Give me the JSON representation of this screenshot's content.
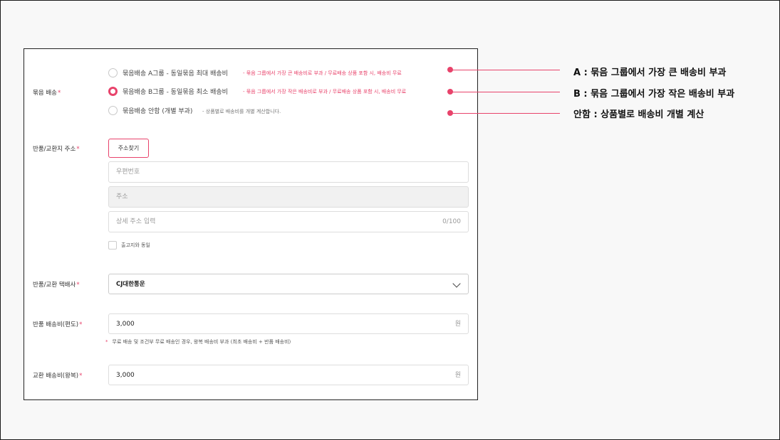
{
  "bundle_shipping": {
    "label": "묶음 배송",
    "required_mark": "*",
    "options": [
      {
        "label": "묶음배송 A그룹 - 동일묶음 최대 배송비",
        "note": "- 묶음 그룹에서 가장 큰 배송비로 부과 / 무료배송 상품 포함 시, 배송비 무료",
        "checked": false
      },
      {
        "label": "묶음배송 B그룹 - 동일묶음 최소 배송비",
        "note": "- 묶음 그룹에서 가장 작은 배송비로 부과 / 무료배송 상품 포함 시, 배송비 무료",
        "checked": true
      },
      {
        "label": "묶음배송 안함 (개별 부과)",
        "note": "- 상품별로 배송비를 개별 계산합니다.",
        "checked": false
      }
    ]
  },
  "return_address": {
    "label": "반품/교환지 주소",
    "required_mark": "*",
    "find_button": "주소찾기",
    "zip_placeholder": "우편번호",
    "address_placeholder": "주소",
    "detail_placeholder": "상세 주소 입력",
    "detail_counter": "0/100",
    "same_as_warehouse": "출고지와 동일"
  },
  "return_courier": {
    "label": "반품/교환 택배사",
    "required_mark": "*",
    "selected": "CJ대한통운"
  },
  "return_fee": {
    "label": "반품 배송비(편도)",
    "required_mark": "*",
    "value": "3,000",
    "unit": "원",
    "hint": "무료 배송 및 조건부 무료 배송인 경우, 왕복 배송비 부과 (최초 배송비 + 반품 배송비)",
    "hint_bullet": "*"
  },
  "exchange_fee": {
    "label": "교환 배송비(왕복)",
    "required_mark": "*",
    "value": "3,000",
    "unit": "원"
  },
  "callouts": [
    "A : 묶음 그룹에서 가장 큰 배송비 부과",
    "B : 묶음 그룹에서 가장 작은 배송비 부과",
    "안함 : 상품별로 배송비 개별 계산"
  ],
  "colors": {
    "accent": "#e8436b",
    "border": "#dddddd",
    "background": "#f8f8f8"
  }
}
